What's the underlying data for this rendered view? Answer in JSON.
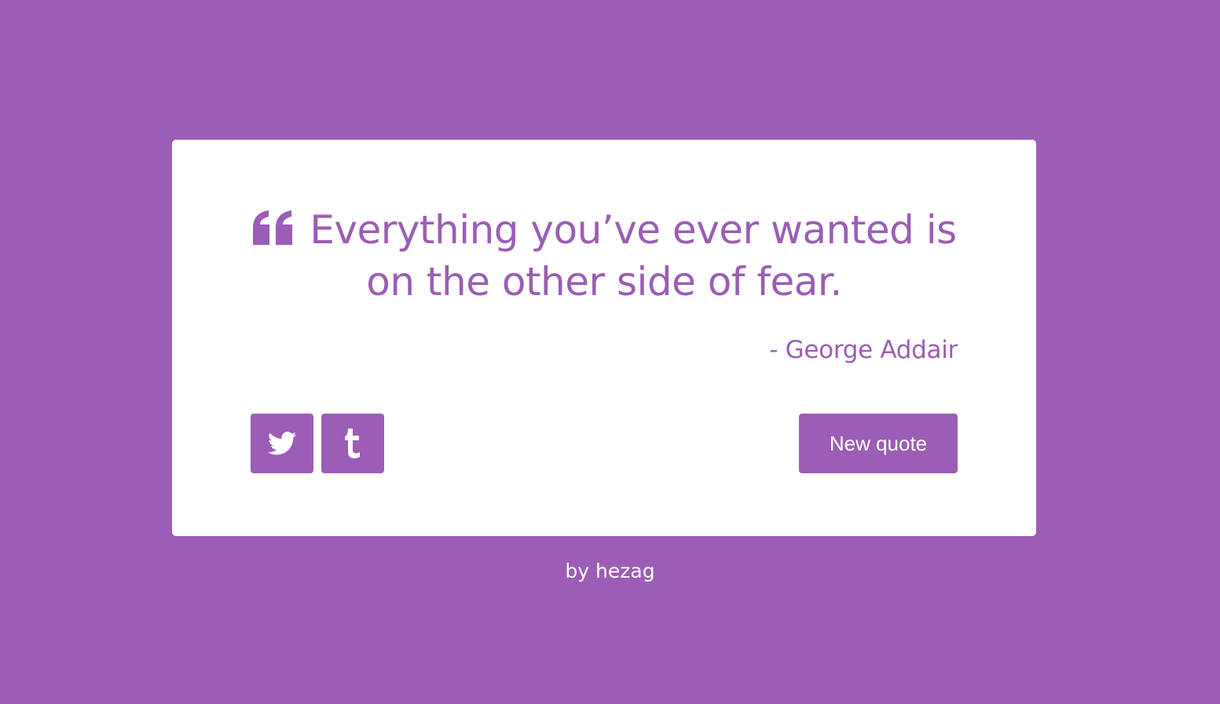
{
  "theme": {
    "background": "#9b5db5",
    "card": "#ffffff",
    "accent": "#9b5db5",
    "button_text": "#ffffff"
  },
  "quote": {
    "icon": "quote-left-icon",
    "text": "Everything you’ve ever wanted is on the other side of fear.",
    "author": "- George Addair"
  },
  "actions": {
    "twitter_icon": "twitter-icon",
    "tumblr_icon": "tumblr-icon",
    "new_quote_label": "New quote"
  },
  "footer": {
    "prefix": "by ",
    "author_link": "hezag"
  }
}
